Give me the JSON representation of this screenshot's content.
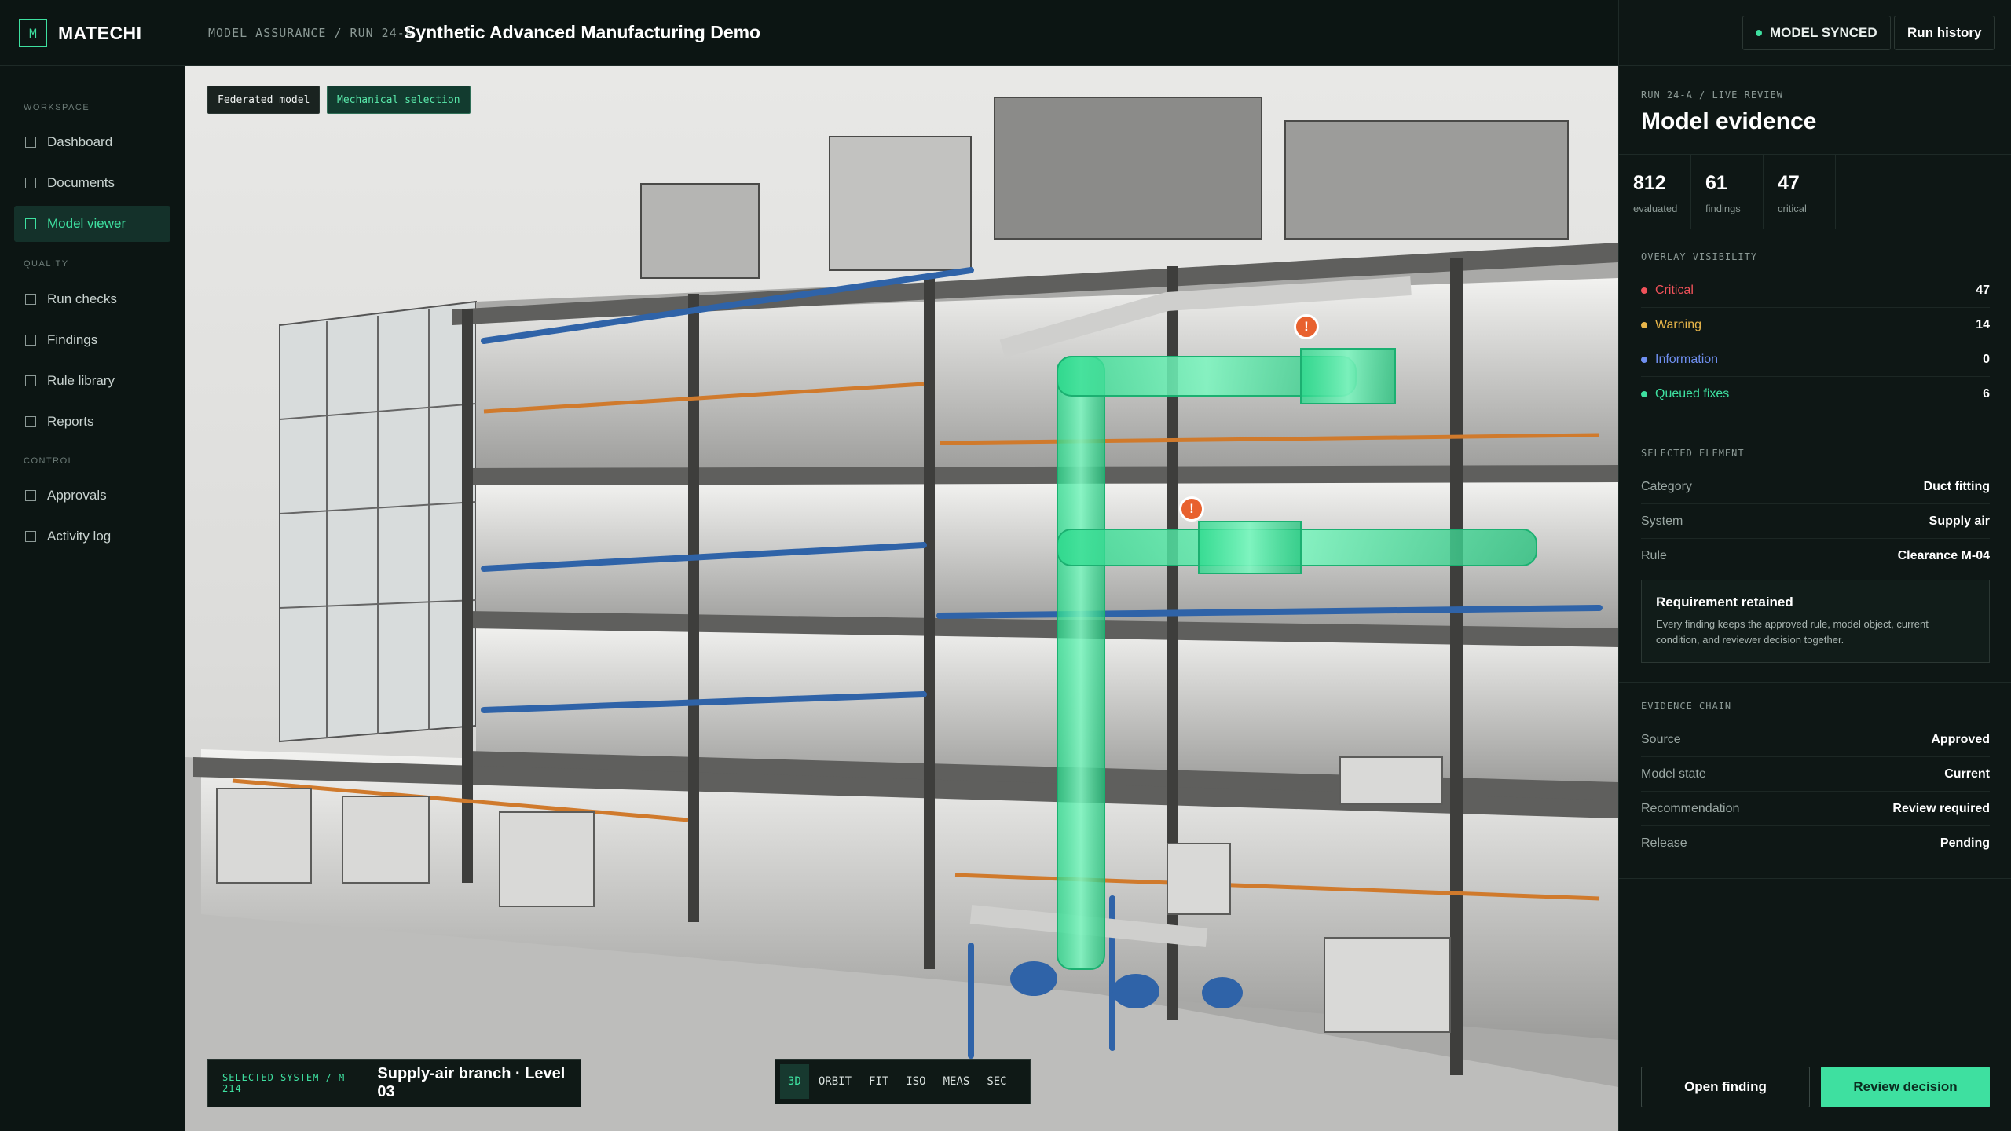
{
  "app": {
    "logo_letter": "M",
    "name": "MATECHI",
    "breadcrumb": "MODEL ASSURANCE / RUN 24-A",
    "page_title": "Synthetic Advanced Manufacturing Demo"
  },
  "sidebar": {
    "sections": [
      {
        "label": "WORKSPACE",
        "items": [
          {
            "label": "Dashboard",
            "active": false
          },
          {
            "label": "Documents",
            "active": false
          },
          {
            "label": "Model viewer",
            "active": true
          }
        ]
      },
      {
        "label": "QUALITY",
        "items": [
          {
            "label": "Run checks",
            "active": false
          },
          {
            "label": "Findings",
            "active": false
          },
          {
            "label": "Rule library",
            "active": false
          },
          {
            "label": "Reports",
            "active": false
          }
        ]
      },
      {
        "label": "CONTROL",
        "items": [
          {
            "label": "Approvals",
            "active": false
          },
          {
            "label": "Activity log",
            "active": false
          }
        ]
      }
    ]
  },
  "viewer": {
    "chips": [
      "Federated model",
      "Mechanical selection"
    ],
    "selected_system_label": "SELECTED SYSTEM / M-214",
    "selected_system_value": "Supply-air branch · Level 03",
    "tools": [
      "3D",
      "ORBIT",
      "FIT",
      "ISO",
      "MEAS",
      "SEC"
    ],
    "active_tool": "3D",
    "issue_marker": "!"
  },
  "header_actions": {
    "status_badge": "MODEL SYNCED",
    "run_history": "Run history"
  },
  "panel": {
    "run_label": "RUN 24-A / LIVE REVIEW",
    "title": "Model evidence",
    "stats": [
      {
        "value": "812",
        "label": "evaluated"
      },
      {
        "value": "61",
        "label": "findings"
      },
      {
        "value": "47",
        "label": "critical"
      }
    ],
    "overlay": {
      "heading": "OVERLAY VISIBILITY",
      "rows": [
        {
          "label": "Critical",
          "count": "47",
          "color": "#f0525a"
        },
        {
          "label": "Warning",
          "count": "14",
          "color": "#e8b64a"
        },
        {
          "label": "Information",
          "count": "0",
          "color": "#6f8ff0"
        },
        {
          "label": "Queued fixes",
          "count": "6",
          "color": "#3ee0a0"
        }
      ]
    },
    "selected_element": {
      "heading": "SELECTED ELEMENT",
      "rows": [
        {
          "key": "Category",
          "value": "Duct fitting"
        },
        {
          "key": "System",
          "value": "Supply air"
        },
        {
          "key": "Rule",
          "value": "Clearance M-04"
        }
      ]
    },
    "notice": {
      "title": "Requirement retained",
      "body": "Every finding keeps the approved rule, model object, current condition, and reviewer decision together."
    },
    "evidence_chain": {
      "heading": "EVIDENCE CHAIN",
      "rows": [
        {
          "key": "Source",
          "value": "Approved"
        },
        {
          "key": "Model state",
          "value": "Current"
        },
        {
          "key": "Recommendation",
          "value": "Review required"
        },
        {
          "key": "Release",
          "value": "Pending"
        }
      ]
    },
    "actions": {
      "open_finding": "Open finding",
      "review_decision": "Review decision"
    }
  },
  "colors": {
    "accent": "#3ee0a0",
    "background": "#0d1614",
    "critical": "#f0525a",
    "warning": "#e8b64a",
    "info": "#6f8ff0"
  }
}
